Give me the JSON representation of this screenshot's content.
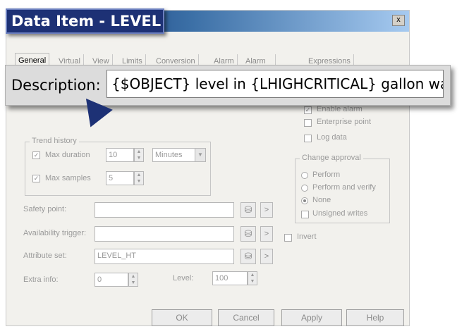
{
  "window": {
    "title": "Data Item - LEVEL",
    "close_glyph": "x"
  },
  "tabs": [
    "General",
    "Virtual",
    "View",
    "Limits",
    "Conversion",
    "Alarm",
    "Alarm Options",
    "Expressions"
  ],
  "description": {
    "label": "Description:",
    "value": "{$OBJECT} level in {LHIGHCRITICAL} gallon wate"
  },
  "right_panel": {
    "enable_alarm": "Enable alarm",
    "enterprise_point": "Enterprise point",
    "log_data": "Log data",
    "change_approval": {
      "title": "Change approval",
      "options": [
        "Perform",
        "Perform and verify",
        "None"
      ],
      "selected": "None"
    },
    "unsigned_writes": "Unsigned writes",
    "invert": "Invert"
  },
  "trend_history": {
    "title": "Trend history",
    "max_duration_label": "Max duration",
    "max_duration_value": "10",
    "duration_unit": "Minutes",
    "max_samples_label": "Max samples",
    "max_samples_value": "5"
  },
  "fields": {
    "safety_point_label": "Safety point:",
    "availability_trigger_label": "Availability trigger:",
    "attribute_set_label": "Attribute set:",
    "attribute_set_value": "LEVEL_HT",
    "extra_info_label": "Extra info:",
    "extra_info_value": "0",
    "level_label": "Level:",
    "level_value": "100"
  },
  "buttons": {
    "ok": "OK",
    "cancel": "Cancel",
    "apply": "Apply",
    "help": "Help"
  }
}
